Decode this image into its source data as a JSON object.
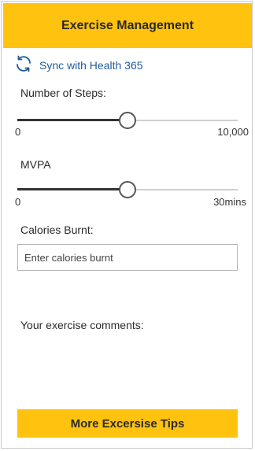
{
  "header": {
    "title": "Exercise Management"
  },
  "sync": {
    "label": "Sync with Health 365",
    "icon": "sync-icon"
  },
  "steps": {
    "label": "Number of Steps:",
    "min_label": "0",
    "max_label": "10,000",
    "value_fraction": 0.5
  },
  "mvpa": {
    "label": "MVPA",
    "min_label": "0",
    "max_label": "30mins",
    "value_fraction": 0.5
  },
  "calories": {
    "label": "Calories Burnt:",
    "placeholder": "Enter calories burnt"
  },
  "comments": {
    "label": "Your exercise comments:"
  },
  "tips_button": {
    "label": "More Excersise Tips"
  },
  "colors": {
    "accent": "#FFC20E",
    "link": "#1F5C99"
  }
}
